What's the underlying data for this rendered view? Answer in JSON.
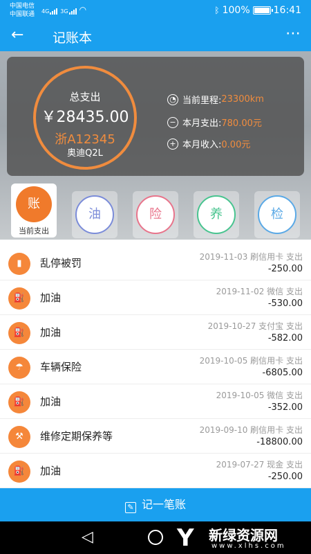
{
  "status_bar": {
    "carrier1": "中国电信",
    "carrier2": "中国联通",
    "net1": "4G",
    "net2": "3G",
    "battery": "100%",
    "time": "16:41"
  },
  "app_bar": {
    "title": "记账本"
  },
  "summary": {
    "label": "总支出",
    "amount": "￥28435.00",
    "plate": "浙A12345",
    "model": "奥迪Q2L",
    "mileage_label": "当前里程:",
    "mileage_value": "23300km",
    "month_expense_label": "本月支出:",
    "month_expense_value": "780.00元",
    "month_income_label": "本月收入:",
    "month_income_value": "0.00元"
  },
  "tabs": [
    {
      "char": "账",
      "label": "当前支出",
      "color": "#f07a2b"
    },
    {
      "char": "油",
      "color": "#7b8cd9"
    },
    {
      "char": "险",
      "color": "#e8748b"
    },
    {
      "char": "养",
      "color": "#48c48f"
    },
    {
      "char": "检",
      "color": "#5aa9e6"
    }
  ],
  "records": [
    {
      "name": "乱停被罚",
      "meta": "2019-11-03 刷信用卡 支出",
      "amount": "-250.00",
      "icon": "traffic-light-icon"
    },
    {
      "name": "加油",
      "meta": "2019-11-02 微信 支出",
      "amount": "-530.00",
      "icon": "fuel-pump-icon"
    },
    {
      "name": "加油",
      "meta": "2019-10-27 支付宝 支出",
      "amount": "-582.00",
      "icon": "fuel-pump-icon"
    },
    {
      "name": "车辆保险",
      "meta": "2019-10-05 刷信用卡 支出",
      "amount": "-6805.00",
      "icon": "umbrella-car-icon"
    },
    {
      "name": "加油",
      "meta": "2019-10-05 微信 支出",
      "amount": "-352.00",
      "icon": "fuel-pump-icon"
    },
    {
      "name": "维修定期保养等",
      "meta": "2019-09-10 刷信用卡 支出",
      "amount": "-18800.00",
      "icon": "repair-car-icon"
    },
    {
      "name": "加油",
      "meta": "2019-07-27 现金 支出",
      "amount": "-250.00",
      "icon": "fuel-pump-icon"
    }
  ],
  "bottom_button": {
    "label": "记一笔账"
  },
  "watermark": {
    "title": "新绿资源网",
    "site": "www.xlhs.com"
  },
  "colors": {
    "primary": "#1aa0ef",
    "accent": "#f08c3e"
  }
}
